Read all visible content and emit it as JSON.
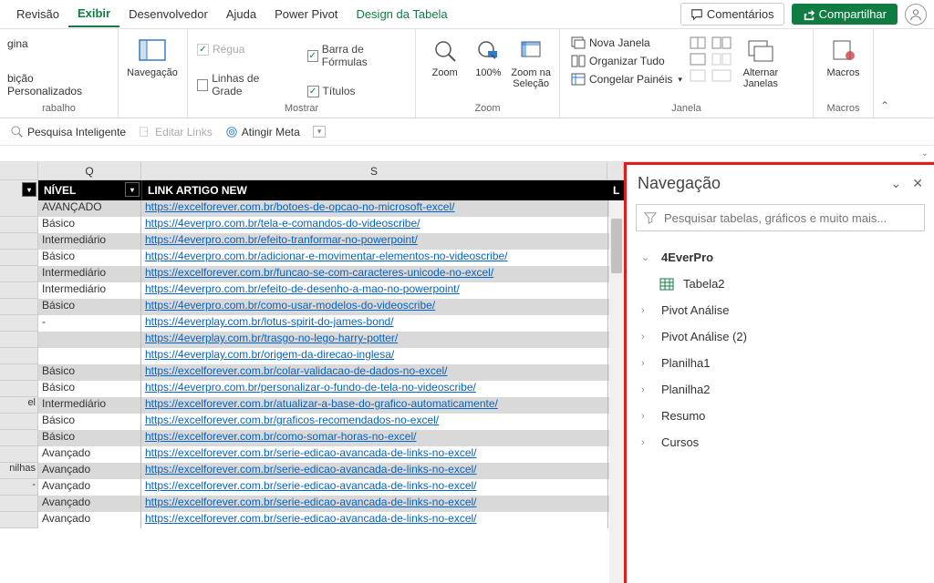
{
  "tabs": {
    "revisao": "Revisão",
    "exibir": "Exibir",
    "desenvolvedor": "Desenvolvedor",
    "ajuda": "Ajuda",
    "powerpivot": "Power Pivot",
    "design": "Design da Tabela"
  },
  "topButtons": {
    "comments": "Comentários",
    "share": "Compartilhar"
  },
  "ribbon": {
    "group1": {
      "line1": "gina",
      "line2": "bição Personalizados",
      "label": "rabalho"
    },
    "nav": {
      "label": "Navegação"
    },
    "mostrar": {
      "regua": "Régua",
      "linhas": "Linhas de Grade",
      "formulas": "Barra de Fórmulas",
      "titulos": "Títulos",
      "label": "Mostrar"
    },
    "zoom": {
      "zoom": "Zoom",
      "cem": "100%",
      "sel": "Zoom na Seleção",
      "label": "Zoom"
    },
    "janela": {
      "nova": "Nova Janela",
      "organizar": "Organizar Tudo",
      "congelar": "Congelar Painéis",
      "alternar": "Alternar Janelas",
      "label": "Janela"
    },
    "macros": {
      "macros": "Macros",
      "label": "Macros"
    }
  },
  "toolbar2": {
    "pesquisa": "Pesquisa Inteligente",
    "editar": "Editar Links",
    "atingir": "Atingir Meta"
  },
  "sheet": {
    "colQ": "Q",
    "colS": "S",
    "hdrNivel": "NÍVEL",
    "hdrLink": "LINK ARTIGO NEW",
    "hdrLast": "L",
    "rows": [
      {
        "nivel": "AVANÇADO",
        "link": "https://excelforever.com.br/botoes-de-opcao-no-microsoft-excel/"
      },
      {
        "nivel": "Básico",
        "link": "https://4everpro.com.br/tela-e-comandos-do-videoscribe/"
      },
      {
        "nivel": "Intermediário",
        "link": "https://4everpro.com.br/efeito-tranformar-no-powerpoint/"
      },
      {
        "nivel": "Básico",
        "link": "https://4everpro.com.br/adicionar-e-movimentar-elementos-no-videoscribe/"
      },
      {
        "nivel": "Intermediário",
        "link": "https://excelforever.com.br/funcao-se-com-caracteres-unicode-no-excel/"
      },
      {
        "nivel": "Intermediário",
        "link": "https://4everpro.com.br/efeito-de-desenho-a-mao-no-powerpoint/"
      },
      {
        "nivel": "Básico",
        "link": "https://4everpro.com.br/como-usar-modelos-do-videoscribe/"
      },
      {
        "nivel": "-",
        "link": "https://4everplay.com.br/lotus-spirit-do-james-bond/"
      },
      {
        "nivel": "",
        "link": "https://4everplay.com.br/trasgo-no-lego-harry-potter/"
      },
      {
        "nivel": "",
        "link": "https://4everplay.com.br/origem-da-direcao-inglesa/"
      },
      {
        "nivel": "Básico",
        "link": "https://excelforever.com.br/colar-validacao-de-dados-no-excel/"
      },
      {
        "nivel": "Básico",
        "link": "https://4everpro.com.br/personalizar-o-fundo-de-tela-no-videoscribe/"
      },
      {
        "nivel": "Intermediário",
        "link": "https://excelforever.com.br/atualizar-a-base-do-grafico-automaticamente/"
      },
      {
        "nivel": "Básico",
        "link": "https://excelforever.com.br/graficos-recomendados-no-excel/"
      },
      {
        "nivel": "Básico",
        "link": "https://excelforever.com.br/como-somar-horas-no-excel/"
      },
      {
        "nivel": "Avançado",
        "link": "https://excelforever.com.br/serie-edicao-avancada-de-links-no-excel/"
      },
      {
        "nivel": "Avançado",
        "link": "https://excelforever.com.br/serie-edicao-avancada-de-links-no-excel/"
      },
      {
        "nivel": "Avançado",
        "link": "https://excelforever.com.br/serie-edicao-avancada-de-links-no-excel/"
      },
      {
        "nivel": "Avançado",
        "link": "https://excelforever.com.br/serie-edicao-avancada-de-links-no-excel/"
      },
      {
        "nivel": "Avançado",
        "link": "https://excelforever.com.br/serie-edicao-avancada-de-links-no-excel/"
      }
    ],
    "rowPrefix": [
      "",
      "",
      "",
      "",
      "",
      "",
      "",
      "",
      "",
      "",
      "",
      "",
      "el",
      "",
      "",
      "",
      "nilhas",
      "-",
      "",
      ""
    ]
  },
  "navPane": {
    "title": "Navegação",
    "searchPlaceholder": "Pesquisar tabelas, gráficos e muito mais...",
    "items": {
      "root": "4EverPro",
      "tabela": "Tabela2",
      "pivot1": "Pivot Análise",
      "pivot2": "Pivot Análise (2)",
      "plan1": "Planilha1",
      "plan2": "Planilha2",
      "resumo": "Resumo",
      "cursos": "Cursos"
    }
  }
}
